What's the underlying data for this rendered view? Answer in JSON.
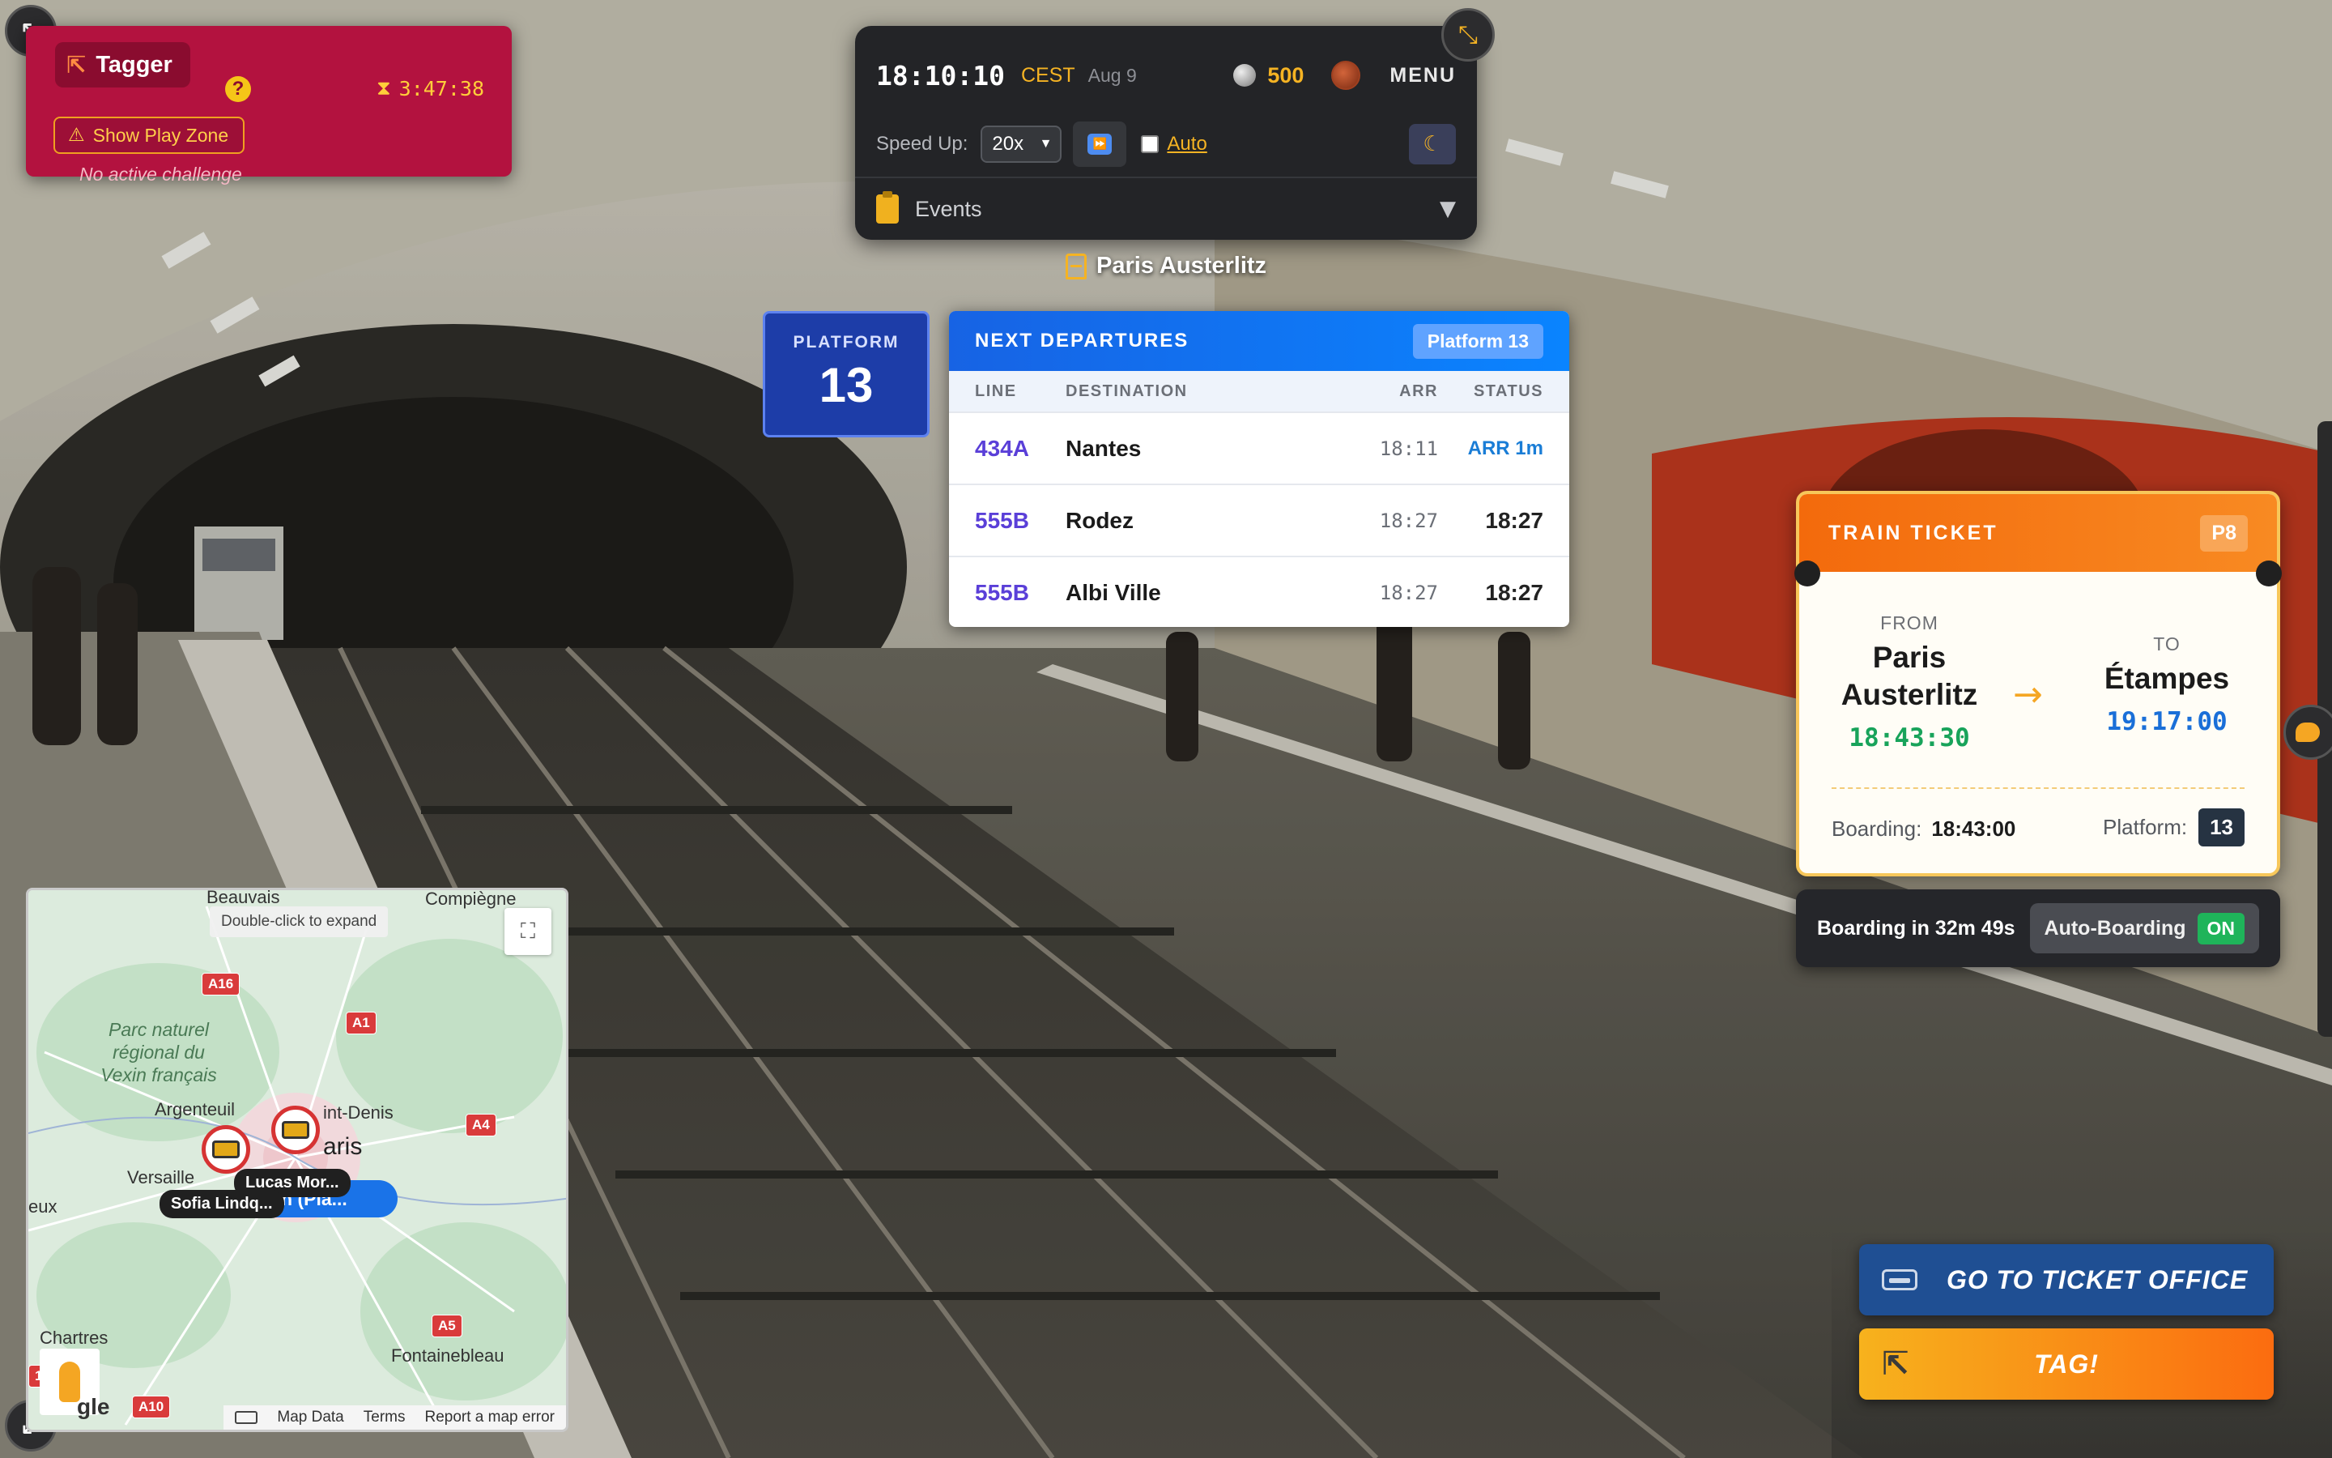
{
  "tagger": {
    "role_label": "Tagger",
    "help_label": "?",
    "timer": "3:47:38",
    "play_zone_button": "Show Play Zone",
    "challenge_status": "No active challenge"
  },
  "clock": {
    "time": "18:10:10",
    "timezone": "CEST",
    "date": "Aug 9",
    "coins": "500",
    "menu_label": "MENU",
    "speed_label": "Speed Up:",
    "speed_value": "20x",
    "auto_label": "Auto",
    "events_label": "Events"
  },
  "station": {
    "name": "Paris Austerlitz"
  },
  "platform": {
    "word": "PLATFORM",
    "number": "13"
  },
  "departures": {
    "title": "NEXT DEPARTURES",
    "platform_pill": "Platform 13",
    "columns": [
      "LINE",
      "DESTINATION",
      "ARR",
      "STATUS"
    ],
    "rows": [
      {
        "line": "434A",
        "destination": "Nantes",
        "arr": "18:11",
        "status": "ARR 1m"
      },
      {
        "line": "555B",
        "destination": "Rodez",
        "arr": "18:27",
        "status": "18:27"
      },
      {
        "line": "555B",
        "destination": "Albi Ville",
        "arr": "18:27",
        "status": "18:27"
      }
    ]
  },
  "ticket": {
    "title": "TRAIN TICKET",
    "code": "P8",
    "from_label": "FROM",
    "from_city": "Paris Austerlitz",
    "from_time": "18:43:30",
    "to_label": "TO",
    "to_city": "Étampes",
    "to_time": "19:17:00",
    "boarding_label": "Boarding:",
    "boarding_time": "18:43:00",
    "platform_label": "Platform:",
    "platform_value": "13"
  },
  "boarding_bar": {
    "countdown": "Boarding in 32m 49s",
    "auto_boarding_label": "Auto-Boarding",
    "auto_boarding_state": "ON"
  },
  "map": {
    "hint": "Double-click to expand",
    "places": {
      "beauvais": "Beauvais",
      "compiegne": "Compiègne",
      "argenteuil": "Argenteuil",
      "saint_denis": "int-Denis",
      "paris": "aris",
      "versailles": "Versaille",
      "eux": "eux",
      "chartres": "Chartres",
      "fontainebleau": "Fontainebleau"
    },
    "region": "Parc naturel régional du Vexin français",
    "roads": {
      "a16": "A16",
      "a1": "A1",
      "a4": "A4",
      "a5": "A5",
      "a10": "A10",
      "n1": "1"
    },
    "players": {
      "sofia": "Sofia Lindq...",
      "lucas": "Lucas Mor..."
    },
    "station_pill": "n (Pla...",
    "google_logo": "gle",
    "footer": {
      "map_data": "Map Data",
      "terms": "Terms",
      "report": "Report a map error"
    }
  },
  "actions": {
    "ticket_office": "GO TO TICKET OFFICE",
    "tag": "TAG!"
  },
  "colors": {
    "tagger_panel": "#b3123f",
    "accent_gold": "#f5b323",
    "departures_header": "#1763e4",
    "ticket_header": "#f36a0c",
    "ticket_office_button": "#1f4f93",
    "auto_boarding_on": "#1fb45a"
  }
}
